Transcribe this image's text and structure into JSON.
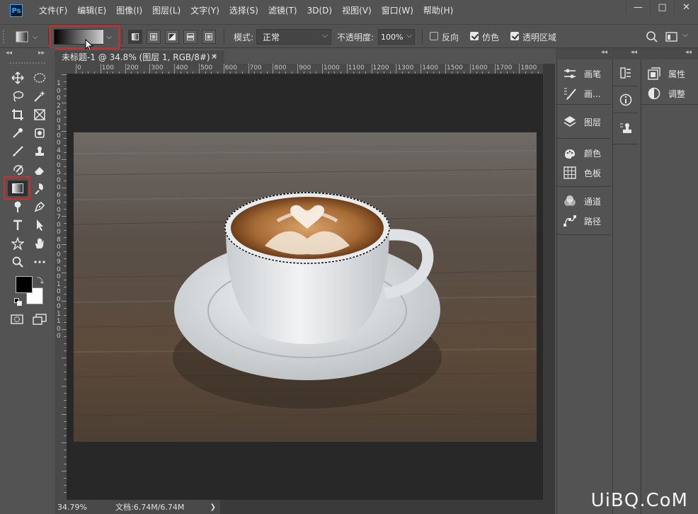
{
  "app": {
    "logo": "Ps"
  },
  "menu": [
    "文件(F)",
    "编辑(E)",
    "图像(I)",
    "图层(L)",
    "文字(Y)",
    "选择(S)",
    "滤镜(T)",
    "3D(D)",
    "视图(V)",
    "窗口(W)",
    "帮助(H)"
  ],
  "window_controls": {
    "minimize": "—",
    "maximize": "□",
    "close": "✕"
  },
  "options": {
    "mode_label": "模式:",
    "mode_value": "正常",
    "opacity_label": "不透明度:",
    "opacity_value": "100%",
    "reverse_label": "反向",
    "reverse_checked": false,
    "dither_label": "仿色",
    "dither_checked": true,
    "transparency_label": "透明区域",
    "transparency_checked": true
  },
  "document": {
    "tab_title": "未标题-1 @ 34.8% (图层 1, RGB/8#) *",
    "close": "✕",
    "ruler_labels": [
      "0",
      "100",
      "200",
      "300",
      "400",
      "500",
      "600",
      "700",
      "800",
      "900",
      "1000",
      "1100",
      "1200",
      "1300",
      "1400",
      "1500",
      "1600",
      "1700",
      "1800"
    ],
    "ruler_v_labels": [
      "1",
      "0",
      "0",
      "2",
      "0",
      "0",
      "3",
      "0",
      "0",
      "4",
      "0",
      "0",
      "5",
      "0",
      "0",
      "6",
      "0",
      "0",
      "7",
      "0",
      "0",
      "8",
      "0",
      "0",
      "9",
      "0",
      "0",
      "1",
      "0",
      "0",
      "0",
      "1",
      "1",
      "0",
      "0"
    ]
  },
  "status": {
    "zoom": "34.79%",
    "doc_size": "文档:6.74M/6.74M",
    "arrow": "❯"
  },
  "panels": {
    "column1": [
      {
        "name": "brush-presets",
        "label": "画笔",
        "icon": "brush-settings-icon"
      },
      {
        "name": "brush",
        "label": "画...",
        "icon": "brush-icon"
      },
      {
        "name": "layers",
        "label": "图层",
        "icon": "layers-icon"
      },
      {
        "name": "color",
        "label": "颜色",
        "icon": "color-icon"
      },
      {
        "name": "swatches",
        "label": "色板",
        "icon": "swatches-icon"
      },
      {
        "name": "channels",
        "label": "通道",
        "icon": "channels-icon"
      },
      {
        "name": "paths",
        "label": "路径",
        "icon": "paths-icon"
      }
    ],
    "column3": [
      {
        "name": "properties",
        "label": "属性",
        "icon": "properties-icon"
      },
      {
        "name": "adjustments",
        "label": "调整",
        "icon": "adjustments-icon"
      }
    ]
  },
  "watermark": "UiBQ.CoM",
  "colors": {
    "ui": "#535353",
    "canvas_bg": "#282828",
    "highlight": "#d42a2a"
  }
}
